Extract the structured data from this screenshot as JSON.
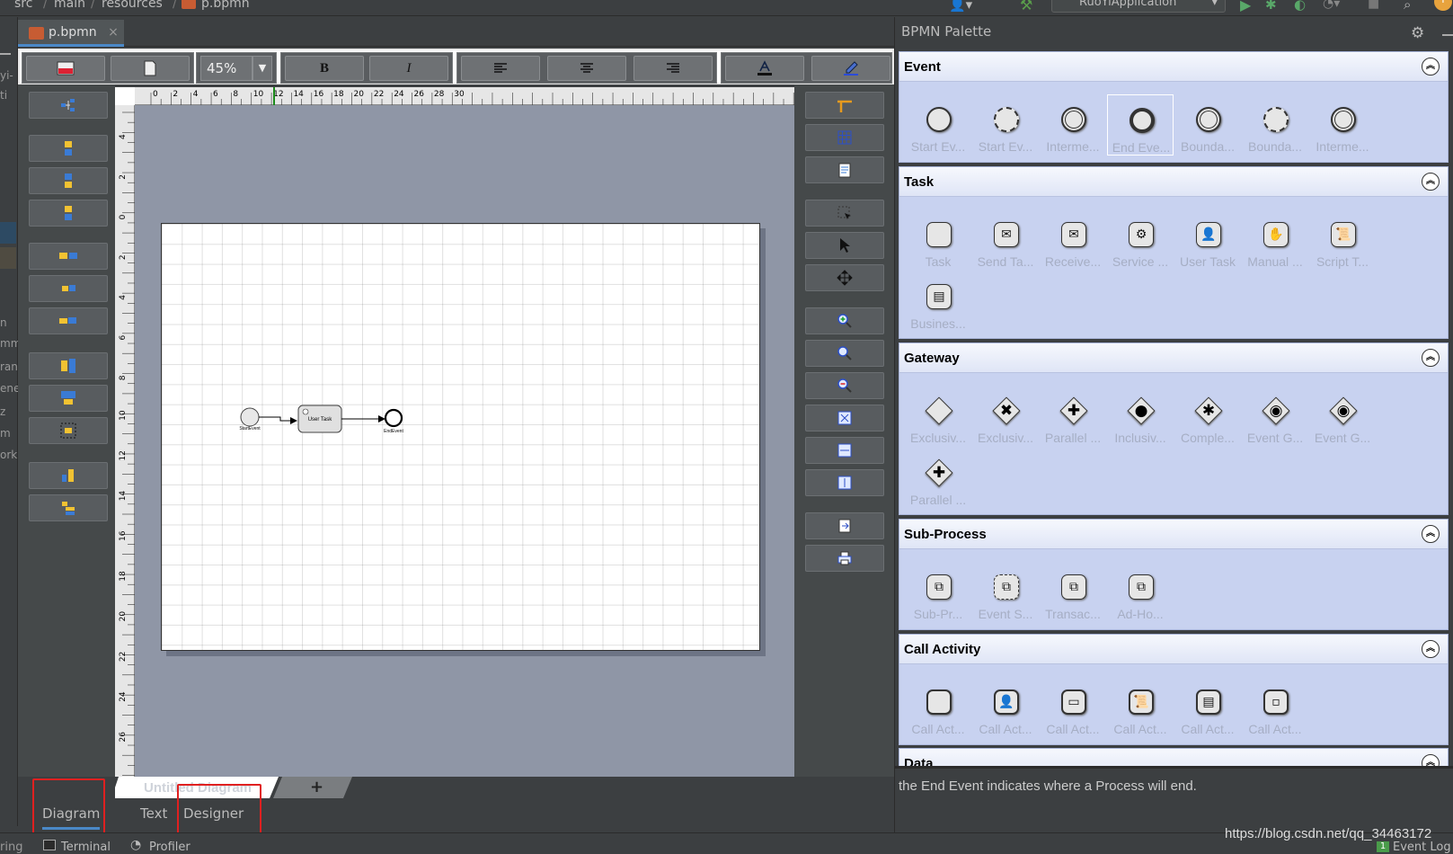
{
  "breadcrumb": [
    "src",
    "main",
    "resources",
    "p.bpmn"
  ],
  "run_config": "RuoYiApplication",
  "editor_tab": {
    "label": "p.bpmn",
    "close": "×"
  },
  "toolbar": {
    "zoom": "45%",
    "bold": "B",
    "italic": "I"
  },
  "ruler": {
    "top_ticks": [
      "0",
      "2",
      "4",
      "6",
      "8",
      "10",
      "12",
      "14",
      "16",
      "18",
      "20",
      "22",
      "24",
      "26",
      "28",
      "30"
    ],
    "left_ticks": [
      "4",
      "2",
      "0",
      "2",
      "4",
      "6",
      "8",
      "10",
      "12",
      "14",
      "16",
      "18",
      "20",
      "22",
      "24",
      "26"
    ]
  },
  "diagram": {
    "start_label": "StartEvent",
    "task_label": "User Task",
    "end_label": "EndEvent"
  },
  "diagram_tabs": {
    "active": "Untitled Diagram",
    "add": "+"
  },
  "bottom_tabs": [
    "Diagram",
    "Text",
    "Designer"
  ],
  "statusbar": {
    "left": "ring",
    "terminal": "Terminal",
    "profiler": "Profiler",
    "event_log": "Event Log",
    "event_count": "1"
  },
  "palette": {
    "title": "BPMN Palette",
    "sections": [
      {
        "name": "Event",
        "items": [
          "Start Ev...",
          "Start Ev...",
          "Interme...",
          "End Eve...",
          "Bounda...",
          "Bounda...",
          "Interme..."
        ]
      },
      {
        "name": "Task",
        "items": [
          "Task",
          "Send Ta...",
          "Receive...",
          "Service ...",
          "User Task",
          "Manual ...",
          "Script T...",
          "Busines..."
        ]
      },
      {
        "name": "Gateway",
        "items": [
          "Exclusiv...",
          "Exclusiv...",
          "Parallel ...",
          "Inclusiv...",
          "Comple...",
          "Event G...",
          "Event G...",
          "Parallel ..."
        ]
      },
      {
        "name": "Sub-Process",
        "items": [
          "Sub-Pr...",
          "Event S...",
          "Transac...",
          "Ad-Ho..."
        ]
      },
      {
        "name": "Call Activity",
        "items": [
          "Call Act...",
          "Call Act...",
          "Call Act...",
          "Call Act...",
          "Call Act...",
          "Call Act..."
        ]
      },
      {
        "name": "Data",
        "items": []
      }
    ],
    "help_text": "the End Event indicates where a Process will end."
  },
  "left_panel_fragments": [
    "yi-",
    "ti",
    "n",
    "mm",
    "ran",
    "ene",
    "z",
    "m",
    "orki"
  ],
  "watermark": "https://blog.csdn.net/qq_34463172",
  "colors": {
    "accent": "#4a88c7",
    "highlight": "#e02020",
    "palette_bg": "#c8d2f0"
  }
}
